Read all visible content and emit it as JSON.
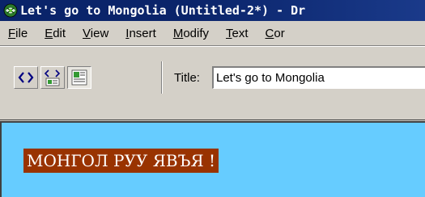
{
  "window": {
    "title": "Let's go to Mongolia (Untitled-2*) - Dr"
  },
  "menu": {
    "items": [
      {
        "mnemonic": "F",
        "rest": "ile"
      },
      {
        "mnemonic": "E",
        "rest": "dit"
      },
      {
        "mnemonic": "V",
        "rest": "iew"
      },
      {
        "mnemonic": "I",
        "rest": "nsert"
      },
      {
        "mnemonic": "M",
        "rest": "odify"
      },
      {
        "mnemonic": "T",
        "rest": "ext"
      },
      {
        "mnemonic": "C",
        "rest": "or"
      }
    ]
  },
  "toolbar": {
    "buttons": [
      {
        "icon": "code-view-icon"
      },
      {
        "icon": "split-view-icon"
      },
      {
        "icon": "design-view-icon"
      }
    ],
    "title_label": "Title:",
    "title_value": "Let's go to Mongolia"
  },
  "document": {
    "text": "МОНГОЛ РУУ ЯВЪЯ !",
    "text_background": "#993300",
    "page_background": "#66ccff"
  },
  "colors": {
    "titlebar": "#0a246a",
    "chrome": "#d4d0c8"
  }
}
